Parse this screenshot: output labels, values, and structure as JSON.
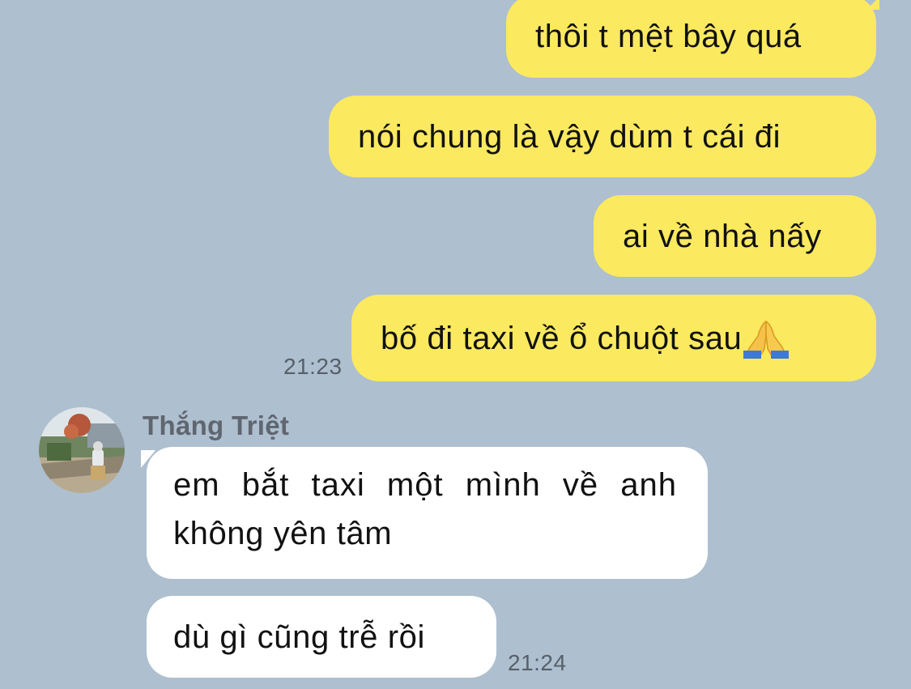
{
  "outgoing_messages": [
    {
      "text": "thôi t mệt bây quá"
    },
    {
      "text": "nói chung là vậy dùm t cái đi"
    },
    {
      "text": "ai về nhà nấy"
    },
    {
      "text": "bố đi taxi về ổ chuột sau",
      "emoji": "folded-hands-emoji"
    }
  ],
  "outgoing_time": "21:23",
  "sender_name": "Thắng Triệt",
  "incoming_messages": [
    {
      "line1": "em bắt taxi một mình về anh",
      "line2": "không yên tâm"
    },
    {
      "text": "dù gì cũng trễ rồi"
    }
  ],
  "incoming_time": "21:24",
  "colors": {
    "background": "#aebfcf",
    "outgoing_bubble": "#fbe960",
    "incoming_bubble": "#ffffff",
    "timestamp": "#56606a",
    "sender_name": "#5f6670"
  }
}
